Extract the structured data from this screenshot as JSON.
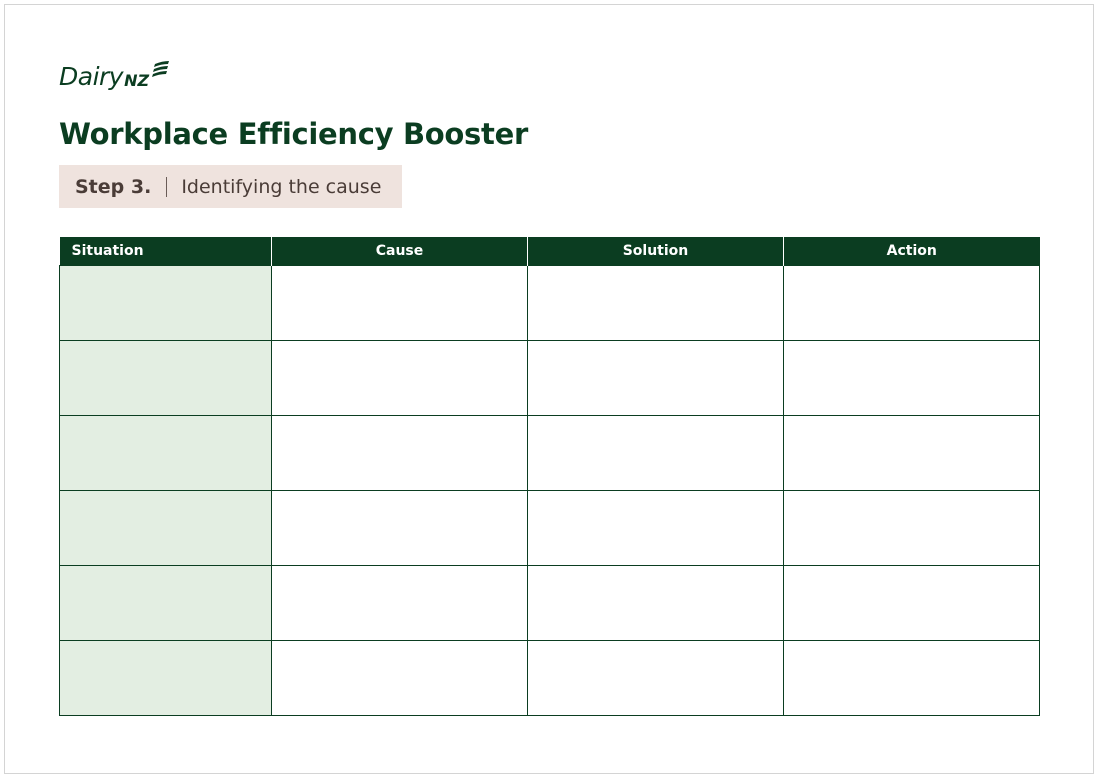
{
  "logo": {
    "word": "Dairy",
    "suffix": "NZ"
  },
  "title": "Workplace Efficiency Booster",
  "step": {
    "number": "Step 3.",
    "label": "Identifying the cause"
  },
  "table": {
    "headers": [
      "Situation",
      "Cause",
      "Solution",
      "Action"
    ],
    "row_count": 6
  },
  "colors": {
    "brand_green": "#0b3d21",
    "step_background": "#efe3de",
    "situation_column": "#e3eee2"
  }
}
